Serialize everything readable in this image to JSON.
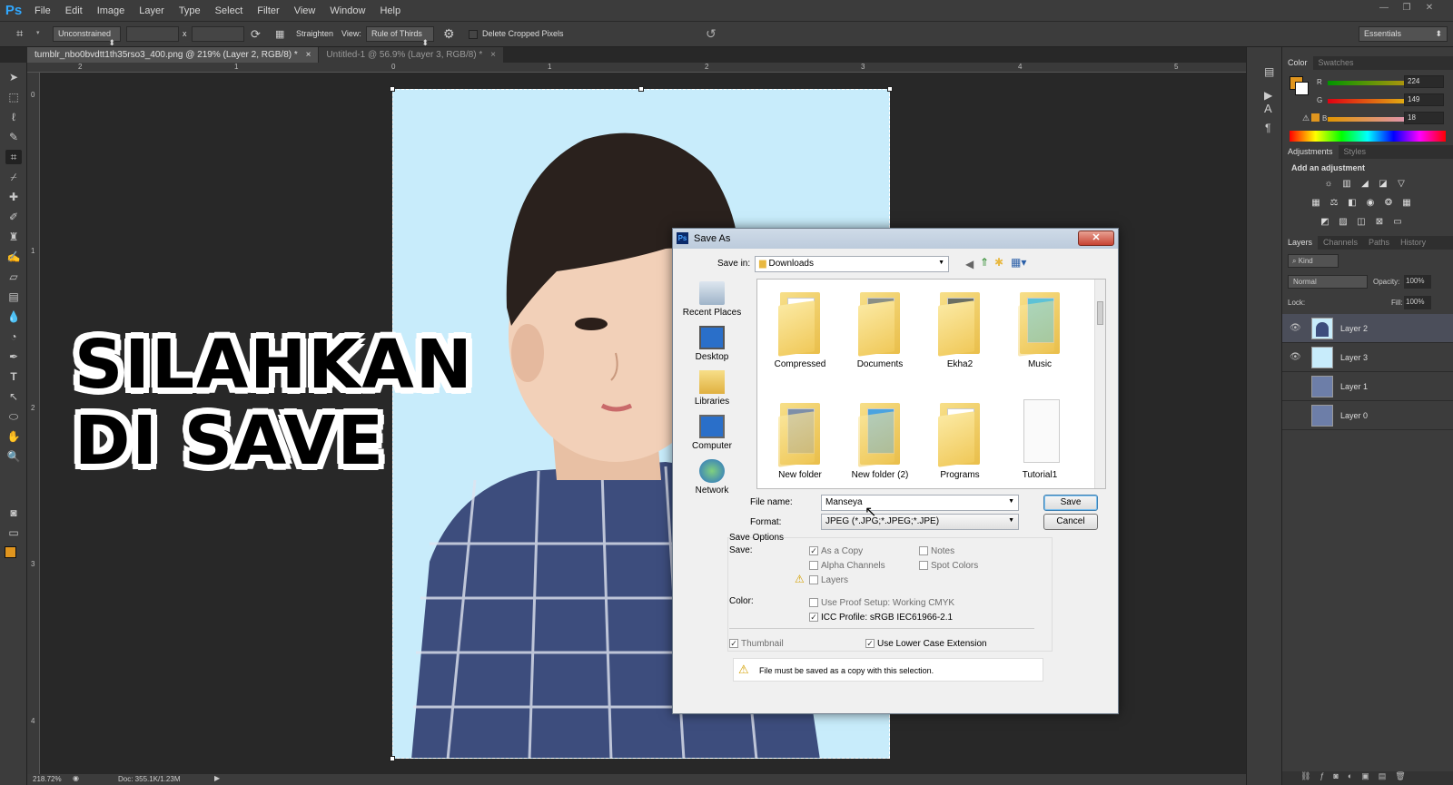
{
  "app": {
    "logo": "Ps",
    "menu": [
      "File",
      "Edit",
      "Image",
      "Layer",
      "Type",
      "Select",
      "Filter",
      "View",
      "Window",
      "Help"
    ]
  },
  "options": {
    "ratio": "Unconstrained",
    "x_sep": "x",
    "straighten": "Straighten",
    "view_label": "View:",
    "view_value": "Rule of Thirds",
    "delete_cropped": "Delete Cropped Pixels",
    "workspace": "Essentials"
  },
  "tabs": [
    "tumblr_nbo0bvdtt1th35rso3_400.png @ 219% (Layer 2, RGB/8) *",
    "Untitled-1 @ 56.9% (Layer 3, RGB/8) *"
  ],
  "hruler": [
    "2",
    "1",
    "0",
    "1",
    "2",
    "3",
    "4",
    "5"
  ],
  "vruler": [
    "0",
    "1",
    "2",
    "3",
    "4"
  ],
  "caption": {
    "line1": "SILAHKAN",
    "line2": "DI SAVE"
  },
  "status": {
    "zoom": "218.72%",
    "doc": "Doc: 355.1K/1.23M"
  },
  "color_panel": {
    "tabs": [
      "Color",
      "Swatches"
    ],
    "r_label": "R",
    "g_label": "G",
    "b_label": "B",
    "r": "224",
    "g": "149",
    "b": "18",
    "fg_color": "#e0951e"
  },
  "adjust_panel": {
    "tabs": [
      "Adjustments",
      "Styles"
    ],
    "heading": "Add an adjustment"
  },
  "layers_panel": {
    "tabs": [
      "Layers",
      "Channels",
      "Paths",
      "History"
    ],
    "kind": "Kind",
    "blend": "Normal",
    "opacity_label": "Opacity:",
    "opacity": "100%",
    "lock_label": "Lock:",
    "fill_label": "Fill:",
    "fill": "100%",
    "layers": [
      {
        "name": "Layer 2",
        "visible": true,
        "selected": true
      },
      {
        "name": "Layer 3",
        "visible": true,
        "selected": false
      },
      {
        "name": "Layer 1",
        "visible": false,
        "selected": false
      },
      {
        "name": "Layer 0",
        "visible": false,
        "selected": false
      }
    ]
  },
  "dialog": {
    "title": "Save As",
    "close": "✕",
    "save_in_label": "Save in:",
    "save_in": "Downloads",
    "places": [
      "Recent Places",
      "Desktop",
      "Libraries",
      "Computer",
      "Network"
    ],
    "files": [
      "Compressed",
      "Documents",
      "Ekha2",
      "Music",
      "New folder",
      "New folder (2)",
      "Programs",
      "Tutorial1"
    ],
    "filename_label": "File name:",
    "filename": "Manseya",
    "format_label": "Format:",
    "format": "JPEG (*.JPG;*.JPEG;*.JPE)",
    "save_btn": "Save",
    "cancel_btn": "Cancel",
    "save_options_label": "Save Options",
    "save_label": "Save:",
    "color_label": "Color:",
    "opt_as_copy": "As a Copy",
    "opt_notes": "Notes",
    "opt_alpha": "Alpha Channels",
    "opt_spot": "Spot Colors",
    "opt_layers": "Layers",
    "opt_proof": "Use Proof Setup:  Working CMYK",
    "opt_icc": "ICC Profile:  sRGB IEC61966-2.1",
    "opt_thumb": "Thumbnail",
    "opt_lower": "Use Lower Case Extension",
    "warning": "File must be saved as a copy with this selection."
  }
}
